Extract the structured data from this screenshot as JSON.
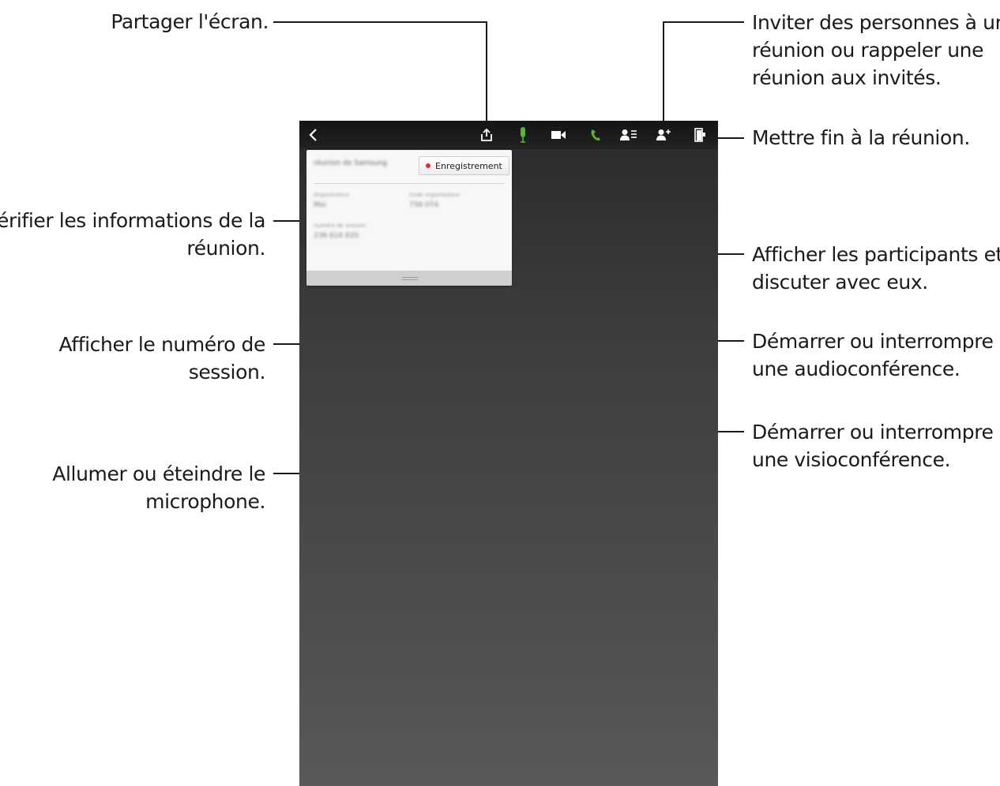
{
  "callouts": {
    "share_screen": "Partager l'écran.",
    "invite_line1": "Inviter des personnes à une",
    "invite_line2": "réunion ou rappeler une",
    "invite_line3": "réunion aux invités.",
    "end_meeting": "Mettre fin à la réunion.",
    "meeting_info_line1": "Vérifier les informations de la",
    "meeting_info_line2": "réunion.",
    "participants_line1": "Afficher les participants et",
    "participants_line2": "discuter avec eux.",
    "session_line1": "Afficher le numéro de",
    "session_line2": "session.",
    "audio_line1": "Démarrer ou interrompre",
    "audio_line2": "une audioconférence.",
    "video_line1": "Démarrer ou interrompre",
    "video_line2": "une visioconférence.",
    "mic_line1": "Allumer ou éteindre le",
    "mic_line2": "microphone."
  },
  "toolbar": {
    "icons": [
      "back-icon",
      "share-screen-icon",
      "microphone-icon",
      "video-camera-icon",
      "phone-icon",
      "participants-icon",
      "add-person-icon",
      "exit-door-icon"
    ],
    "mic_color": "#5cb531",
    "phone_color": "#5cb531"
  },
  "card": {
    "title": "réunion de Samsung",
    "record_label": "Enregistrement",
    "record_dot_color": "#e5262a",
    "organizer_label": "Organisateur",
    "organizer_value": "Moi",
    "org_code_label": "Code organisateur",
    "org_code_value": "756 074",
    "session_label": "numéro de session",
    "session_value": "236 616 620"
  }
}
